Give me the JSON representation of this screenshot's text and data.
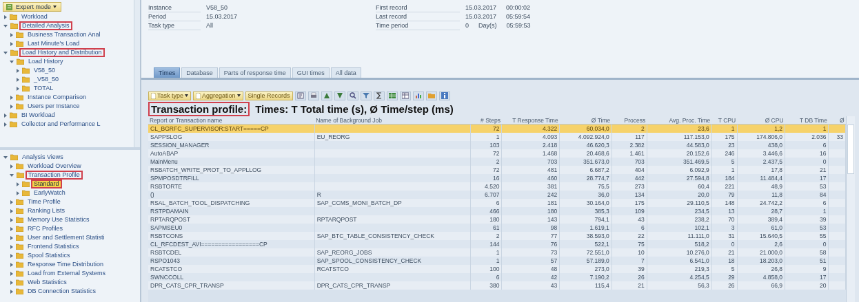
{
  "navigation": {
    "mode_button": "Expert mode",
    "upper_tree": [
      {
        "label": "Workload",
        "expanded": false,
        "selected": false,
        "highlighted": false
      },
      {
        "label": "Detailed Analysis",
        "expanded": true,
        "selected": false,
        "highlighted": true,
        "children": [
          {
            "label": "Business Transaction Anal",
            "expanded": false,
            "selected": false,
            "highlighted": false
          },
          {
            "label": "Last Minute's Load",
            "expanded": false,
            "selected": false,
            "highlighted": false
          }
        ]
      },
      {
        "label": "Load History and Distribution",
        "expanded": true,
        "selected": false,
        "highlighted": true,
        "children": [
          {
            "label": "Load History",
            "expanded": true,
            "selected": false,
            "highlighted": false,
            "children": [
              {
                "label": "V58_50",
                "expanded": false,
                "selected": false,
                "highlighted": false
              },
              {
                "label": "_V58_50",
                "expanded": false,
                "selected": false,
                "highlighted": false
              },
              {
                "label": "TOTAL",
                "expanded": false,
                "selected": false,
                "highlighted": false
              }
            ]
          },
          {
            "label": "Instance Comparison",
            "expanded": false,
            "selected": false,
            "highlighted": false
          },
          {
            "label": "Users per Instance",
            "expanded": false,
            "selected": false,
            "highlighted": false
          }
        ]
      },
      {
        "label": "BI Workload",
        "expanded": false,
        "selected": false,
        "highlighted": false
      },
      {
        "label": "Collector and Performance L",
        "expanded": false,
        "selected": false,
        "highlighted": false
      }
    ],
    "lower_tree": [
      {
        "label": "Analysis Views",
        "expanded": true,
        "selected": false,
        "highlighted": false,
        "children": [
          {
            "label": "Workload Overview",
            "expanded": false,
            "selected": false,
            "highlighted": false
          },
          {
            "label": "Transaction Profile",
            "expanded": true,
            "selected": false,
            "highlighted": true,
            "children": [
              {
                "label": "Standard",
                "expanded": false,
                "selected": true,
                "highlighted": true
              },
              {
                "label": "EarlyWatch",
                "expanded": false,
                "selected": false,
                "highlighted": false
              }
            ]
          },
          {
            "label": "Time Profile",
            "expanded": false,
            "selected": false,
            "highlighted": false
          },
          {
            "label": "Ranking Lists",
            "expanded": false,
            "selected": false,
            "highlighted": false
          },
          {
            "label": "Memory Use Statistics",
            "expanded": false,
            "selected": false,
            "highlighted": false
          },
          {
            "label": "RFC Profiles",
            "expanded": false,
            "selected": false,
            "highlighted": false
          },
          {
            "label": "User and Settlement Statisti",
            "expanded": false,
            "selected": false,
            "highlighted": false
          },
          {
            "label": "Frontend Statistics",
            "expanded": false,
            "selected": false,
            "highlighted": false
          },
          {
            "label": "Spool Statistics",
            "expanded": false,
            "selected": false,
            "highlighted": false
          },
          {
            "label": "Response Time Distribution",
            "expanded": false,
            "selected": false,
            "highlighted": false
          },
          {
            "label": "Load from External Systems",
            "expanded": false,
            "selected": false,
            "highlighted": false
          },
          {
            "label": "Web Statistics",
            "expanded": false,
            "selected": false,
            "highlighted": false
          },
          {
            "label": "DB Connection Statistics",
            "expanded": false,
            "selected": false,
            "highlighted": false
          }
        ]
      }
    ]
  },
  "info": {
    "left": [
      {
        "label": "Instance",
        "values": [
          "V58_50"
        ]
      },
      {
        "label": "Period",
        "values": [
          "15.03.2017"
        ]
      },
      {
        "label": "Task type",
        "values": [
          "All"
        ]
      }
    ],
    "right": [
      {
        "label": "First record",
        "values": [
          "15.03.2017",
          "00:00:02"
        ]
      },
      {
        "label": "Last record",
        "values": [
          "15.03.2017",
          "05:59:54"
        ]
      },
      {
        "label": "Time period",
        "values": [
          "0",
          "Day(s)",
          "05:59:53"
        ]
      }
    ]
  },
  "tabs": [
    {
      "label": "Times",
      "selected": true
    },
    {
      "label": "Database",
      "selected": false
    },
    {
      "label": "Parts of response time",
      "selected": false
    },
    {
      "label": "GUI times",
      "selected": false
    },
    {
      "label": "All data",
      "selected": false
    }
  ],
  "toolbar": {
    "buttons": [
      "Task type",
      "Aggregation",
      "Single Records"
    ]
  },
  "title": {
    "label": "Transaction profile:",
    "text": "Times: T Total time (s), Ø Time/step (ms)",
    "highlighted": true
  },
  "table": {
    "columns": [
      "Report or Transaction name",
      "Name of Background Job",
      "# Steps",
      "T Response Time",
      "Ø Time",
      "Process",
      "Avg. Proc. Time",
      "T CPU",
      "Ø CPU",
      "T DB Time",
      "Ø"
    ],
    "rows": [
      {
        "selected": true,
        "cells": [
          "CL_BGRFC_SUPERVISOR:START=====CP",
          "",
          "72",
          "4.322",
          "60.034,0",
          "2",
          "23,6",
          "1",
          "1,2",
          "1",
          ""
        ]
      },
      {
        "selected": false,
        "cells": [
          "SAPPSLOG",
          "EU_REORG",
          "1",
          "4.093",
          "4.092.924,0",
          "117",
          "117.153,0",
          "175",
          "174.806,0",
          "2.036",
          "33"
        ]
      },
      {
        "selected": false,
        "cells": [
          "SESSION_MANAGER",
          "",
          "103",
          "2.418",
          "46.620,3",
          "2.382",
          "44.583,0",
          "23",
          "438,0",
          "6",
          ""
        ]
      },
      {
        "selected": false,
        "cells": [
          "AutoABAP",
          "",
          "72",
          "1.468",
          "20.468,6",
          "1.461",
          "20.152,6",
          "246",
          "3.446,6",
          "16",
          ""
        ]
      },
      {
        "selected": false,
        "cells": [
          "MainMenu",
          "",
          "2",
          "703",
          "351.673,0",
          "703",
          "351.469,5",
          "5",
          "2.437,5",
          "0",
          ""
        ]
      },
      {
        "selected": false,
        "cells": [
          "RSBATCH_WRITE_PROT_TO_APPLLOG",
          "",
          "72",
          "481",
          "6.687,2",
          "404",
          "6.092,9",
          "1",
          "17,8",
          "21",
          ""
        ]
      },
      {
        "selected": false,
        "cells": [
          "SPMPOSDTRFILL",
          "",
          "16",
          "460",
          "28.774,7",
          "442",
          "27.594,8",
          "184",
          "11.484,4",
          "17",
          ""
        ]
      },
      {
        "selected": false,
        "cells": [
          "RSBTORTE",
          "",
          "4.520",
          "381",
          "75,5",
          "273",
          "60,4",
          "221",
          "48,9",
          "53",
          ""
        ]
      },
      {
        "selected": false,
        "cells": [
          "()",
          "R",
          "6.707",
          "242",
          "36,0",
          "134",
          "20,0",
          "79",
          "11,8",
          "84",
          ""
        ]
      },
      {
        "selected": false,
        "cells": [
          "RSAL_BATCH_TOOL_DISPATCHING",
          "SAP_CCMS_MONI_BATCH_DP",
          "6",
          "181",
          "30.164,0",
          "175",
          "29.110,5",
          "148",
          "24.742,2",
          "6",
          ""
        ]
      },
      {
        "selected": false,
        "cells": [
          "RSTPDAMAIN",
          "",
          "466",
          "180",
          "385,3",
          "109",
          "234,5",
          "13",
          "28,7",
          "1",
          ""
        ]
      },
      {
        "selected": false,
        "cells": [
          "RPTARQPOST",
          "RPTARQPOST",
          "180",
          "143",
          "794,1",
          "43",
          "238,2",
          "70",
          "389,4",
          "39",
          ""
        ]
      },
      {
        "selected": false,
        "cells": [
          "SAPMSEU0",
          "",
          "61",
          "98",
          "1.619,1",
          "6",
          "102,1",
          "3",
          "61,0",
          "53",
          ""
        ]
      },
      {
        "selected": false,
        "cells": [
          "RSBTCONS",
          "SAP_BTC_TABLE_CONSISTENCY_CHECK",
          "2",
          "77",
          "38.593,0",
          "22",
          "11.111,0",
          "31",
          "15.640,5",
          "55",
          ""
        ]
      },
      {
        "selected": false,
        "cells": [
          "CL_RFCDEST_AVI=================CP",
          "",
          "144",
          "76",
          "522,1",
          "75",
          "518,2",
          "0",
          "2,6",
          "0",
          ""
        ]
      },
      {
        "selected": false,
        "cells": [
          "RSBTCDEL",
          "SAP_REORG_JOBS",
          "1",
          "73",
          "72.551,0",
          "10",
          "10.276,0",
          "21",
          "21.000,0",
          "58",
          ""
        ]
      },
      {
        "selected": false,
        "cells": [
          "RSPO1043",
          "SAP_SPOOL_CONSISTENCY_CHECK",
          "1",
          "57",
          "57.189,0",
          "7",
          "6.541,0",
          "18",
          "18.203,0",
          "51",
          ""
        ]
      },
      {
        "selected": false,
        "cells": [
          "RCATSTCO",
          "RCATSTCO",
          "100",
          "48",
          "273,0",
          "39",
          "219,3",
          "5",
          "26,8",
          "9",
          ""
        ]
      },
      {
        "selected": false,
        "cells": [
          "SWNCCOLL",
          "",
          "6",
          "42",
          "7.190,2",
          "26",
          "4.254,5",
          "29",
          "4.858,0",
          "17",
          ""
        ]
      },
      {
        "selected": false,
        "cells": [
          "DPR_CATS_CPR_TRANSP",
          "DPR_CATS_CPR_TRANSP",
          "380",
          "43",
          "115,4",
          "21",
          "56,3",
          "26",
          "66,9",
          "20",
          ""
        ]
      }
    ]
  }
}
